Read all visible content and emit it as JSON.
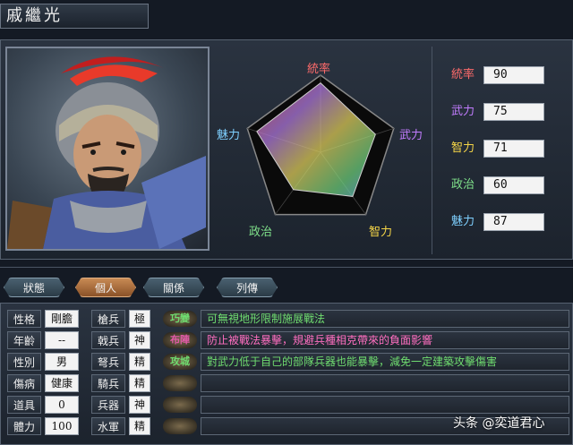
{
  "character": {
    "name": "戚繼光"
  },
  "radar": {
    "labels": [
      "統率",
      "武力",
      "智力",
      "政治",
      "魅力"
    ],
    "label_colors": [
      "#ff6b6b",
      "#c27cff",
      "#f5d547",
      "#7fe08a",
      "#7fd0ff"
    ],
    "values": [
      90,
      75,
      71,
      60,
      87
    ],
    "max": 100
  },
  "stats": [
    {
      "label": "統率",
      "value": "90",
      "color": "#ff6b6b"
    },
    {
      "label": "武力",
      "value": "75",
      "color": "#c27cff"
    },
    {
      "label": "智力",
      "value": "71",
      "color": "#f5d547"
    },
    {
      "label": "政治",
      "value": "60",
      "color": "#7fe08a"
    },
    {
      "label": "魅力",
      "value": "87",
      "color": "#7fd0ff"
    }
  ],
  "tabs": [
    {
      "label": "狀態",
      "active": false
    },
    {
      "label": "個人",
      "active": true
    },
    {
      "label": "關係",
      "active": false
    },
    {
      "label": "列傳",
      "active": false
    }
  ],
  "personal": [
    {
      "label": "性格",
      "value": "剛膽"
    },
    {
      "label": "年齡",
      "value": "--"
    },
    {
      "label": "性別",
      "value": "男"
    },
    {
      "label": "傷病",
      "value": "健康"
    },
    {
      "label": "道具",
      "value": "0"
    },
    {
      "label": "體力",
      "value": "100"
    }
  ],
  "aptitude": [
    {
      "label": "槍兵",
      "value": "極"
    },
    {
      "label": "戟兵",
      "value": "神"
    },
    {
      "label": "弩兵",
      "value": "精"
    },
    {
      "label": "騎兵",
      "value": "精"
    },
    {
      "label": "兵器",
      "value": "神"
    },
    {
      "label": "水軍",
      "value": "精"
    }
  ],
  "skills": [
    {
      "name": "巧變",
      "name_color": "#6fdc6f",
      "desc": "可無視地形限制施展戰法",
      "desc_color": "#6fdc6f"
    },
    {
      "name": "布陣",
      "name_color": "#e25aa8",
      "desc": "防止被戰法暴擊，規避兵種相克帶來的負面影響",
      "desc_color": "#ff6fc0"
    },
    {
      "name": "攻城",
      "name_color": "#6fdc6f",
      "desc": "對武力低于自己的部隊兵器也能暴擊，減免一定建築攻擊傷害",
      "desc_color": "#6fdc6f"
    },
    {
      "name": "",
      "name_color": "#cccccc",
      "desc": "",
      "desc_color": "#cccccc"
    },
    {
      "name": "",
      "name_color": "#cccccc",
      "desc": "",
      "desc_color": "#cccccc"
    },
    {
      "name": "",
      "name_color": "#cccccc",
      "desc": "",
      "desc_color": "#cccccc"
    }
  ],
  "watermark": {
    "text": "头条 @奕道君心"
  }
}
